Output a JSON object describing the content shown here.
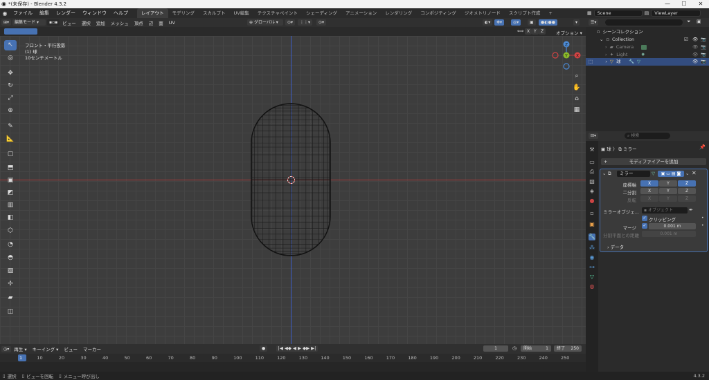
{
  "window": {
    "title": "*(未保存) - Blender 4.3.2",
    "controls": [
      "—",
      "☐",
      "✕"
    ]
  },
  "menu": {
    "items": [
      "ファイル",
      "編集",
      "レンダー",
      "ウィンドウ",
      "ヘルプ"
    ]
  },
  "workspaces": [
    "レイアウト",
    "モデリング",
    "スカルプト",
    "UV編集",
    "テクスチャペイント",
    "シェーディング",
    "アニメーション",
    "レンダリング",
    "コンポジティング",
    "ジオメトリノード",
    "スクリプト作成"
  ],
  "workspace_add": "+",
  "scene": {
    "name": "Scene",
    "view_layer": "ViewLayer"
  },
  "viewport_header": {
    "mode": "編集モード",
    "menus": [
      "ビュー",
      "選択",
      "追加",
      "メッシュ",
      "頂点",
      "辺",
      "面",
      "UV"
    ],
    "transform_orientation": "グローバル",
    "axes": [
      "X",
      "Y",
      "Z"
    ],
    "options": "オプション"
  },
  "viewport_overlay": {
    "view_name": "フロント・平行投影",
    "object_name": "(1) 球",
    "scale": "10センチメートル"
  },
  "gizmo": {
    "x": "X",
    "y": "Y",
    "z": "Z"
  },
  "timeline": {
    "menus": [
      "再生",
      "キーイング",
      "ビュー",
      "マーカー"
    ],
    "current_frame": "1",
    "start_label": "開始",
    "start": "1",
    "end_label": "終了",
    "end": "250",
    "ticks": [
      "1",
      "10",
      "20",
      "30",
      "40",
      "50",
      "60",
      "70",
      "80",
      "90",
      "100",
      "110",
      "120",
      "130",
      "140",
      "150",
      "160",
      "170",
      "180",
      "190",
      "200",
      "210",
      "220",
      "230",
      "240",
      "250"
    ]
  },
  "status": {
    "select": "選択",
    "rotate": "ビューを回転",
    "menu": "メニュー呼び出し",
    "version": "4.3.2"
  },
  "outliner": {
    "root": "シーンコレクション",
    "collection": "Collection",
    "items": [
      "Camera",
      "Light",
      "球"
    ]
  },
  "properties": {
    "search_placeholder": "検索",
    "breadcrumb_object": "球",
    "breadcrumb_sep": "〉",
    "breadcrumb_modifier": "ミラー",
    "add_modifier": "モディファイアーを追加",
    "modifier_name": "ミラー",
    "axis_label": "座標軸",
    "bisect_label": "二分割",
    "flip_label": "反転",
    "axis_buttons": [
      "X",
      "Y",
      "Z"
    ],
    "mirror_object_label": "ミラーオブジェ...",
    "mirror_object_placeholder": "オブジェクト",
    "clipping_label": "クリッピング",
    "merge_label": "マージ",
    "merge_value": "0.001 m",
    "bisect_distance_label": "分割平面との距離",
    "bisect_distance_value": "0.001 m",
    "data_panel": "データ"
  },
  "colors": {
    "accent": "#4772b3",
    "x_axis": "#a33b3b",
    "y_axis": "#8bbb2a",
    "z_axis": "#4c8bd6",
    "z_line": "#3c5ec8"
  }
}
